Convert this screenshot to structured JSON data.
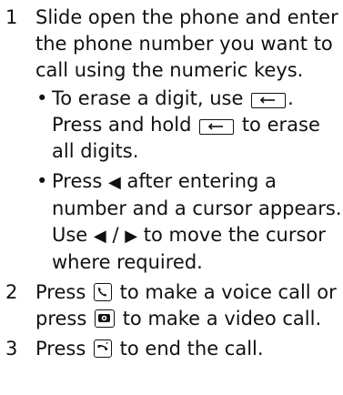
{
  "steps": [
    {
      "number": "1",
      "text": "Slide open the phone and enter the phone number you want to call using the numeric keys.",
      "sub": [
        {
          "a": "To erase a digit, use",
          "b": ".",
          "c": "Press and hold",
          "d": "to erase all digits."
        },
        {
          "a": "Press",
          "b": "after entering a number and a cursor appears. Use",
          "sep": "/",
          "c": "to move the cursor where required."
        }
      ]
    },
    {
      "number": "2",
      "a": "Press",
      "b": "to make a voice call or press",
      "c": "to make a video call."
    },
    {
      "number": "3",
      "a": "Press",
      "b": "to end the call."
    }
  ],
  "glyphs": {
    "bullet": "•",
    "left_arrow": "◀",
    "right_arrow": "▶"
  },
  "icons": {
    "clear_key": "clear-key-icon",
    "call_key": "call-key-icon",
    "video_call_key": "video-call-key-icon",
    "end_key": "end-key-icon"
  }
}
